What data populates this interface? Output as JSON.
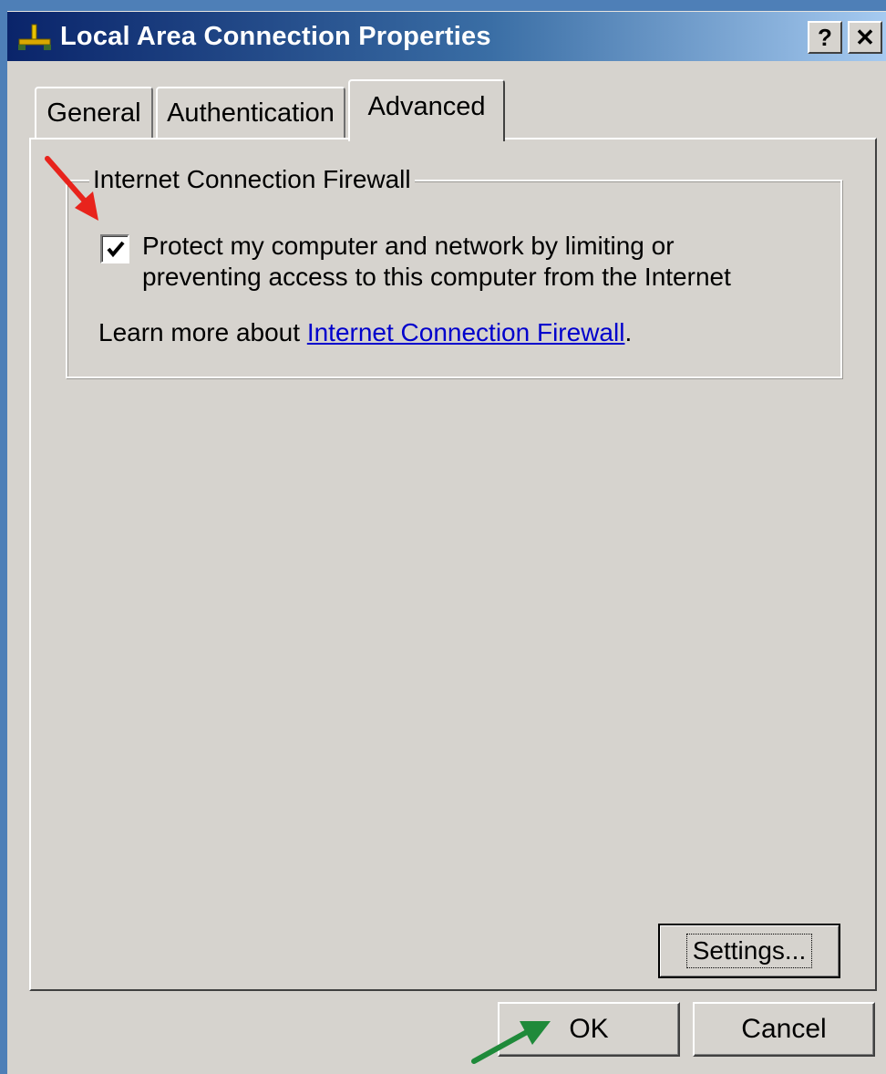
{
  "window": {
    "title": "Local Area Connection Properties",
    "help_label": "?",
    "close_label": "✕"
  },
  "tabs": [
    {
      "label": "General",
      "active": false
    },
    {
      "label": "Authentication",
      "active": false
    },
    {
      "label": "Advanced",
      "active": true
    }
  ],
  "firewall_group": {
    "legend": "Internet Connection Firewall",
    "checkbox_label": "Protect my computer and network by limiting or preventing access to this computer from the Internet",
    "checked": true,
    "learn_more_prefix": "Learn more about ",
    "learn_more_link": "Internet Connection Firewall",
    "learn_more_suffix": "."
  },
  "buttons": {
    "settings": "Settings...",
    "ok": "OK",
    "cancel": "Cancel"
  },
  "colors": {
    "titlebar_start": "#0a246a",
    "titlebar_end": "#a6caf0",
    "dialog_bg": "#d6d3ce",
    "link": "#0000cc",
    "annotation_red": "#e8231c",
    "annotation_green": "#1f8a3a",
    "desktop_bg": "#4e7fb7"
  },
  "icons": {
    "title": "network-connection-icon",
    "help": "help-icon",
    "close": "close-icon",
    "check": "check-icon"
  }
}
